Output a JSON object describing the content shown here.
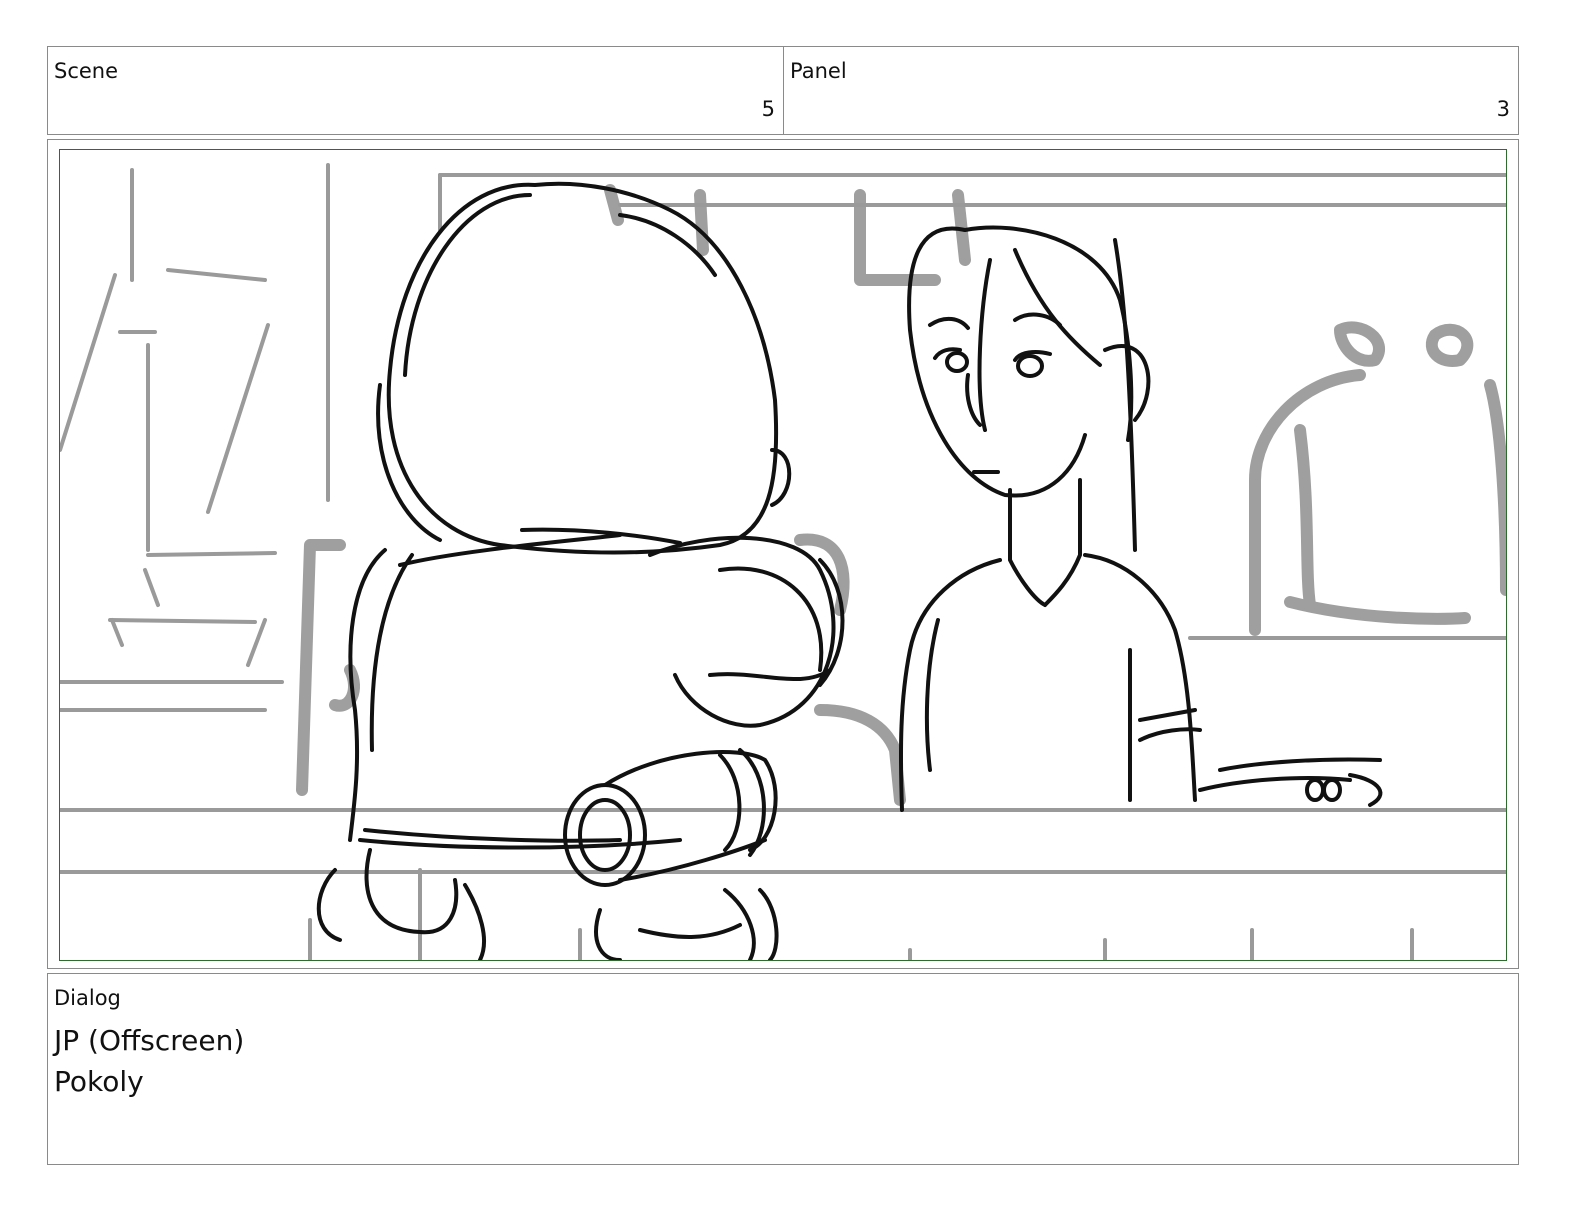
{
  "header": {
    "scene_label": "Scene",
    "scene_value": "5",
    "panel_label": "Panel",
    "panel_value": "3"
  },
  "artwork": {
    "type": "storyboard-sketch",
    "frame_color": "#2e6b2e",
    "ink_color": "#111111",
    "background_ink_color": "#9a9a9a"
  },
  "dialog": {
    "label": "Dialog",
    "lines": [
      "JP (Offscreen)",
      "Pokoly"
    ]
  }
}
